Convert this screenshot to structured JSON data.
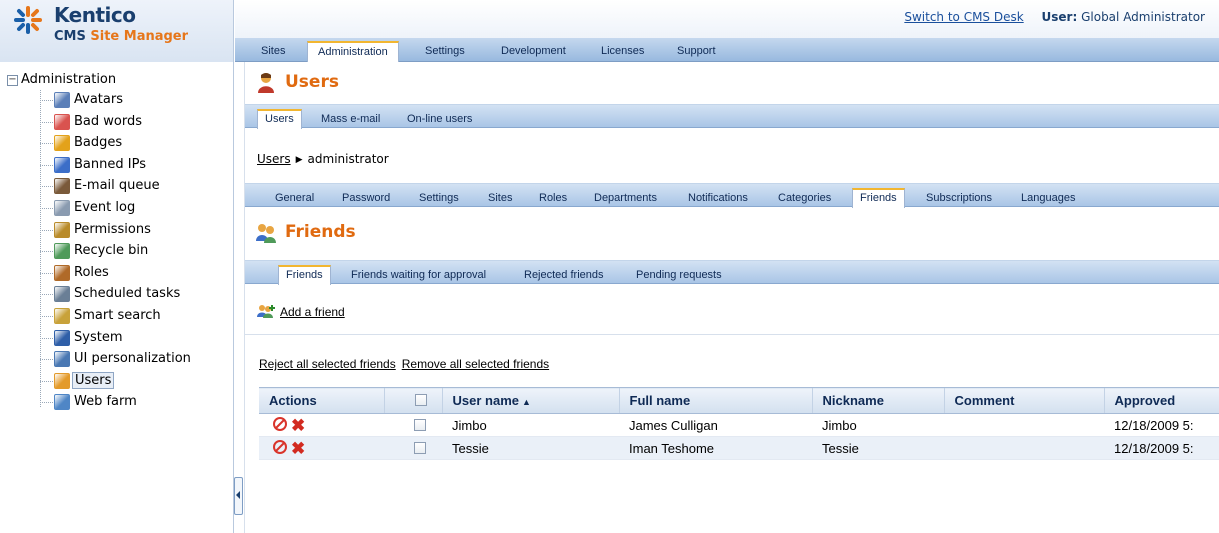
{
  "app": {
    "brand_name": "Kentico",
    "brand_sub_prefix": "CMS",
    "brand_sub_highlight": "Site Manager"
  },
  "header": {
    "switch_link": "Switch to CMS Desk",
    "user_label": "User:",
    "user_name": "Global Administrator"
  },
  "main_tabs": [
    {
      "label": "Sites"
    },
    {
      "label": "Administration",
      "active": true
    },
    {
      "label": "Settings"
    },
    {
      "label": "Development"
    },
    {
      "label": "Licenses"
    },
    {
      "label": "Support"
    }
  ],
  "tree": {
    "root_label": "Administration",
    "expander": "−",
    "items": [
      {
        "label": "Avatars",
        "icon": "avatars-icon",
        "color": "#5b7fb8"
      },
      {
        "label": "Bad words",
        "icon": "bad-words-icon",
        "color": "#d9534f"
      },
      {
        "label": "Badges",
        "icon": "badges-icon",
        "color": "#e3a21a"
      },
      {
        "label": "Banned IPs",
        "icon": "banned-ips-icon",
        "color": "#3c6ec8"
      },
      {
        "label": "E-mail queue",
        "icon": "email-queue-icon",
        "color": "#7a5a3a"
      },
      {
        "label": "Event log",
        "icon": "event-log-icon",
        "color": "#8a9bb0"
      },
      {
        "label": "Permissions",
        "icon": "permissions-icon",
        "color": "#b98b2a"
      },
      {
        "label": "Recycle bin",
        "icon": "recycle-bin-icon",
        "color": "#4f9a5a"
      },
      {
        "label": "Roles",
        "icon": "roles-icon",
        "color": "#b06a28"
      },
      {
        "label": "Scheduled tasks",
        "icon": "scheduled-tasks-icon",
        "color": "#6a7f96"
      },
      {
        "label": "Smart search",
        "icon": "smart-search-icon",
        "color": "#c8a23a"
      },
      {
        "label": "System",
        "icon": "system-icon",
        "color": "#2f5fa8"
      },
      {
        "label": "UI personalization",
        "icon": "ui-personalization-icon",
        "color": "#4a78b3"
      },
      {
        "label": "Users",
        "icon": "users-icon",
        "color": "#e39a2a",
        "selected": true
      },
      {
        "label": "Web farm",
        "icon": "web-farm-icon",
        "color": "#4f86c6"
      }
    ]
  },
  "page": {
    "title": "Users",
    "user_tabs": [
      {
        "label": "Users",
        "active": true
      },
      {
        "label": "Mass e-mail"
      },
      {
        "label": "On-line users"
      }
    ],
    "breadcrumb": {
      "link": "Users",
      "current": "administrator"
    },
    "edit_tabs": [
      {
        "label": "General"
      },
      {
        "label": "Password"
      },
      {
        "label": "Settings"
      },
      {
        "label": "Sites"
      },
      {
        "label": "Roles"
      },
      {
        "label": "Departments"
      },
      {
        "label": "Notifications"
      },
      {
        "label": "Categories"
      },
      {
        "label": "Friends",
        "active": true
      },
      {
        "label": "Subscriptions"
      },
      {
        "label": "Languages"
      }
    ],
    "section_title": "Friends",
    "friend_tabs": [
      {
        "label": "Friends",
        "active": true
      },
      {
        "label": "Friends waiting for approval"
      },
      {
        "label": "Rejected friends"
      },
      {
        "label": "Pending requests"
      }
    ],
    "add_friend": "Add a friend",
    "bulk": {
      "reject_all": "Reject all selected friends",
      "remove_all": "Remove all selected friends"
    },
    "grid": {
      "columns": [
        "Actions",
        "",
        "User name",
        "Full name",
        "Nickname",
        "Comment",
        "Approved"
      ],
      "sort_indicator": "▲",
      "rows": [
        {
          "username": "Jimbo",
          "fullname": "James Culligan",
          "nickname": "Jimbo",
          "comment": "",
          "approved": "12/18/2009 5:"
        },
        {
          "username": "Tessie",
          "fullname": "Iman Teshome",
          "nickname": "Tessie",
          "comment": "",
          "approved": "12/18/2009 5:"
        }
      ]
    }
  }
}
